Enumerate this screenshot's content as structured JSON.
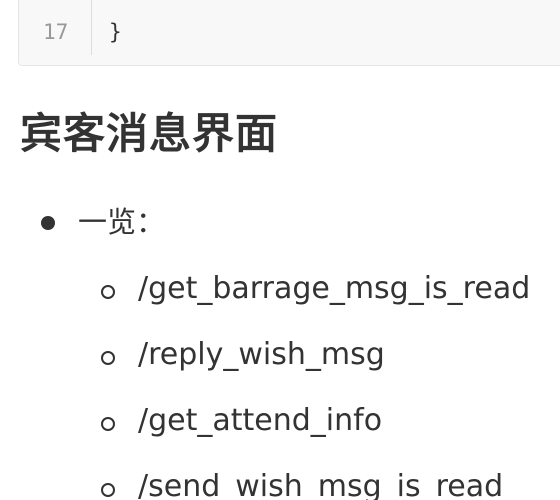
{
  "code_block": {
    "line_number": "17",
    "code": "}"
  },
  "heading": "宾客消息界面",
  "list": {
    "item": "一览：",
    "subitems": [
      "/get_barrage_msg_is_read",
      "/reply_wish_msg",
      "/get_attend_info",
      "/send_wish_msg_is_read"
    ]
  }
}
